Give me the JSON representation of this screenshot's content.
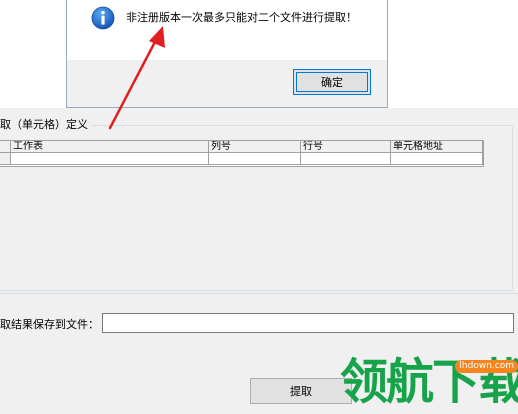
{
  "dialog": {
    "message": "非注册版本一次最多只能对二个文件进行提取！",
    "ok_label": "确定",
    "icon": "info-icon"
  },
  "extraction": {
    "group_title": "取（单元格）定义",
    "grid": {
      "columns": [
        "工作表",
        "列号",
        "行号",
        "单元格地址"
      ],
      "rows": [
        [
          "",
          "",
          "",
          ""
        ]
      ]
    }
  },
  "save": {
    "label": "取结果保存到文件：",
    "value": ""
  },
  "actions": {
    "extract_label": "提取"
  },
  "watermark": {
    "text": "领航下载",
    "badge": "lhdown.com"
  },
  "colors": {
    "annotation_arrow": "#e02020",
    "dialog_focus": "#0078d7",
    "watermark_green": "#17a34a",
    "watermark_badge": "#f6851f"
  }
}
